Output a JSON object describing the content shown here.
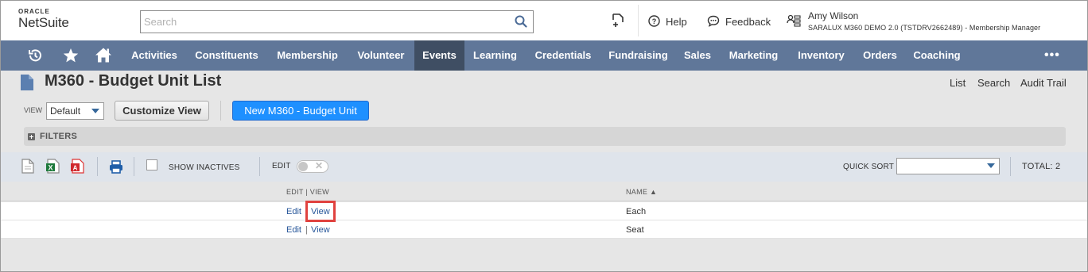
{
  "header": {
    "logo_top": "ORACLE",
    "logo_bottom": "NetSuite",
    "search_placeholder": "Search",
    "help": "Help",
    "feedback": "Feedback",
    "user_name": "Amy Wilson",
    "user_role": "SARALUX M360 DEMO 2.0 (TSTDRV2662489) - Membership Manager"
  },
  "nav": {
    "items": [
      "Activities",
      "Constituents",
      "Membership",
      "Volunteer",
      "Events",
      "Learning",
      "Credentials",
      "Fundraising",
      "Sales",
      "Marketing",
      "Inventory",
      "Orders",
      "Coaching"
    ],
    "active": "Events",
    "more": "•••"
  },
  "page": {
    "title": "M360 - Budget Unit List",
    "links": [
      "List",
      "Search",
      "Audit Trail"
    ],
    "view_label": "VIEW",
    "view_value": "Default",
    "customize_view": "Customize View",
    "new_button": "New M360 - Budget Unit",
    "filters": "FILTERS"
  },
  "toolbar": {
    "show_inactives": "SHOW INACTIVES",
    "edit_label": "EDIT",
    "quick_sort": "QUICK SORT",
    "total": "TOTAL: 2"
  },
  "table": {
    "col_editview": "EDIT | VIEW",
    "col_name": "NAME ▲",
    "rows": [
      {
        "edit": "Edit",
        "view": "View",
        "name": "Each"
      },
      {
        "edit": "Edit",
        "view": "View",
        "name": "Seat"
      }
    ]
  },
  "colors": {
    "nav_bg": "#607799",
    "nav_active": "#3f4e63",
    "primary_button": "#1e90ff",
    "link": "#255599",
    "highlight": "#e0423f"
  }
}
